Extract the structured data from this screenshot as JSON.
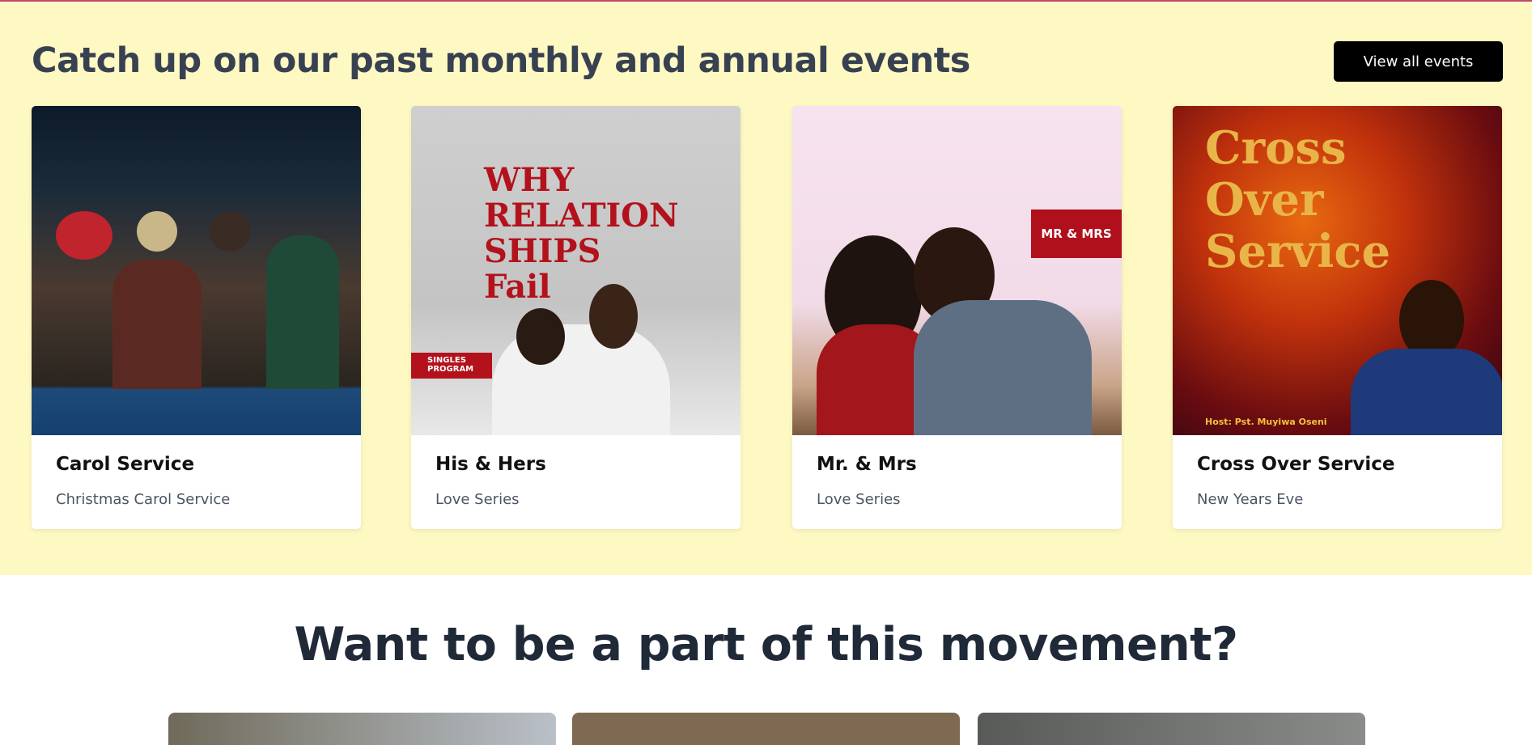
{
  "events_section": {
    "title": "Catch up on our past monthly and annual events",
    "view_all_label": "View all events",
    "background": "#fef8c2",
    "cards": [
      {
        "title": "Carol Service",
        "subtitle": "Christmas Carol Service",
        "poster_text": ""
      },
      {
        "title": "His & Hers",
        "subtitle": "Love Series",
        "poster_text": "WHY RELATION SHIPS Fail",
        "poster_badge": "SINGLES PROGRAM"
      },
      {
        "title": "Mr. & Mrs",
        "subtitle": "Love Series",
        "poster_badge": "MR & MRS"
      },
      {
        "title": "Cross Over Service",
        "subtitle": "New Years Eve",
        "poster_text": "Cross Over Service",
        "poster_host": "Host: Pst. Muyiwa Oseni"
      }
    ]
  },
  "movement_section": {
    "title": "Want to be a part of this movement?"
  }
}
